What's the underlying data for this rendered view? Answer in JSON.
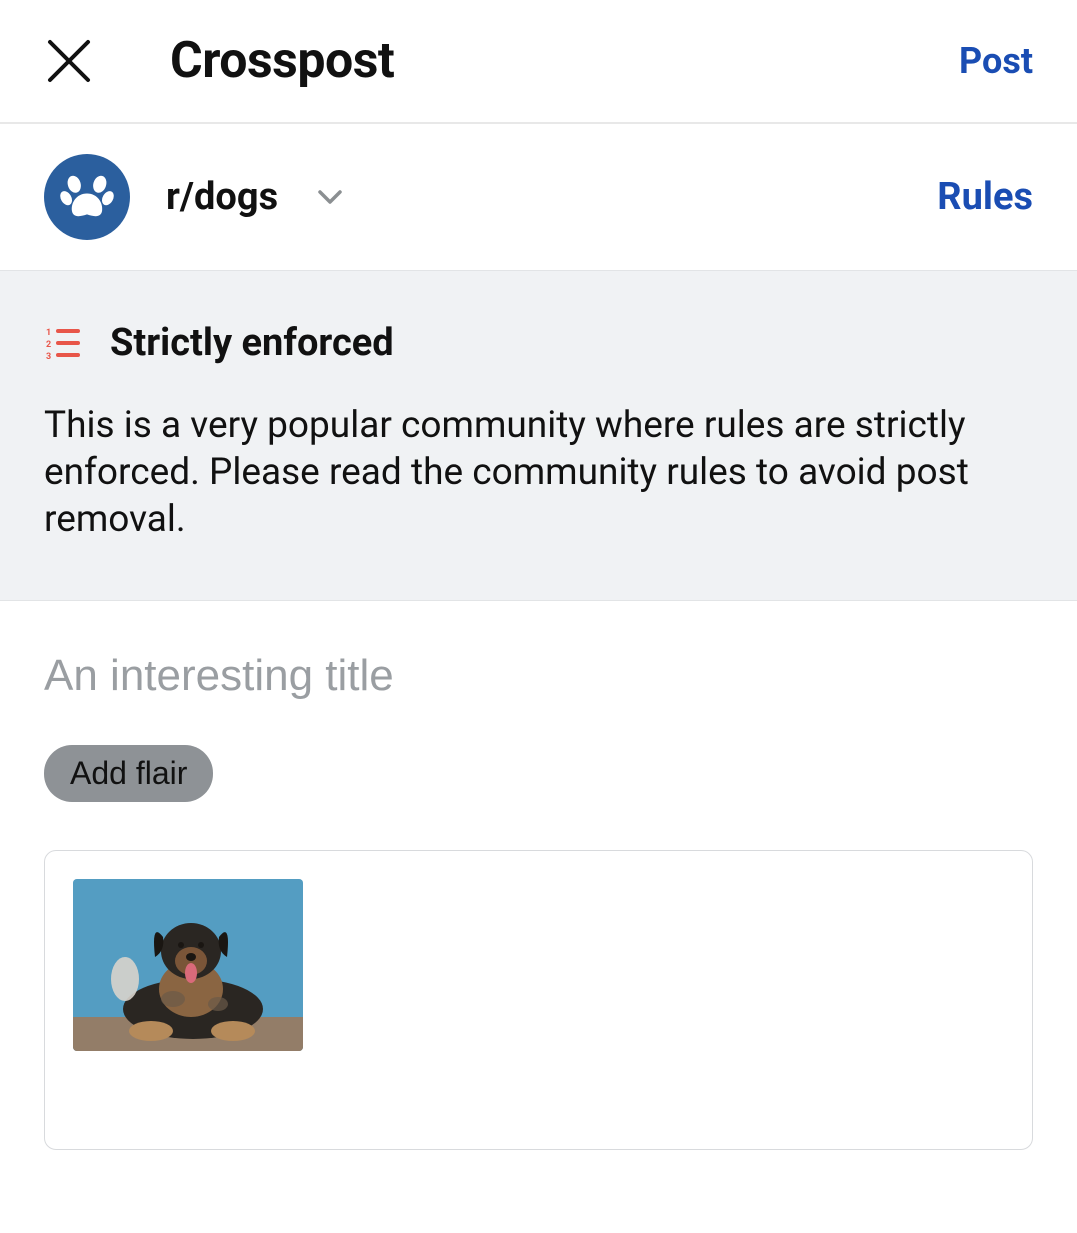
{
  "header": {
    "title": "Crosspost",
    "post_label": "Post"
  },
  "community": {
    "name": "r/dogs",
    "rules_label": "Rules",
    "icon_name": "paw-icon"
  },
  "notice": {
    "title": "Strictly enforced",
    "body": "This is a very popular community where rules are strictly enforced. Please read the community rules to avoid post removal.",
    "icon_name": "numbered-list-icon"
  },
  "form": {
    "title_placeholder": "An interesting title",
    "title_value": "",
    "flair_button_label": "Add flair"
  },
  "preview": {
    "thumbnail_alt": "dog-photo"
  },
  "colors": {
    "accent": "#1a4db3",
    "community_icon_bg": "#2b5f9e",
    "notice_bg": "#f0f2f4",
    "flair_bg": "#8e9296"
  }
}
